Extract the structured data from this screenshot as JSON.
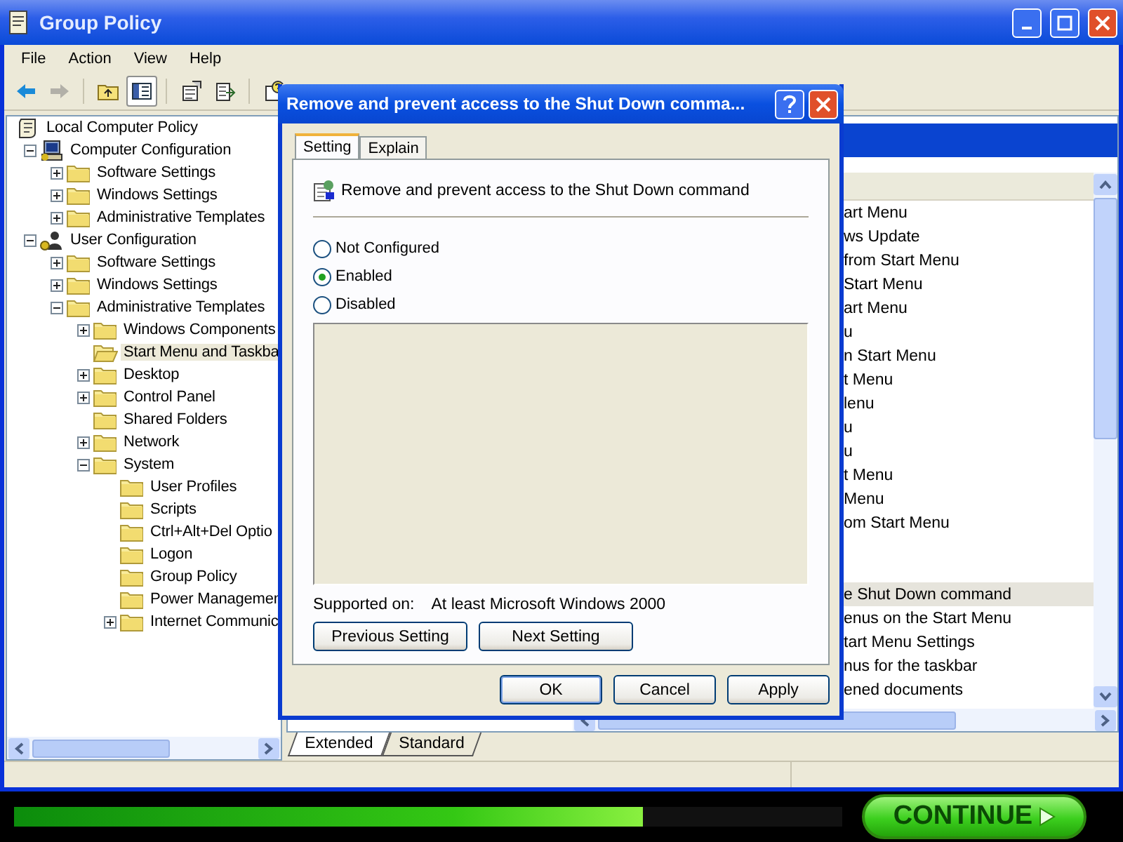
{
  "window": {
    "title": "Group Policy"
  },
  "menu": [
    "File",
    "Action",
    "View",
    "Help"
  ],
  "toolbar": [
    {
      "kind": "back",
      "disabled": false,
      "pressed": false
    },
    {
      "kind": "forward",
      "disabled": true,
      "pressed": false
    },
    {
      "kind": "up",
      "disabled": false,
      "pressed": false
    },
    {
      "kind": "tree",
      "disabled": false,
      "pressed": true
    },
    {
      "kind": "properties",
      "disabled": false,
      "pressed": false
    },
    {
      "kind": "export",
      "disabled": false,
      "pressed": false
    },
    {
      "kind": "help",
      "disabled": false,
      "pressed": false
    }
  ],
  "tree": [
    {
      "label": "Local Computer Policy",
      "kind": "policy",
      "selected": false,
      "children": [
        {
          "label": "Computer Configuration",
          "kind": "computer",
          "expanded": true,
          "selected": false,
          "children": [
            {
              "label": "Software Settings",
              "kind": "folder",
              "expanded": false,
              "selected": false
            },
            {
              "label": "Windows Settings",
              "kind": "folder",
              "expanded": false,
              "selected": false
            },
            {
              "label": "Administrative Templates",
              "kind": "folder",
              "expanded": false,
              "selected": false
            }
          ]
        },
        {
          "label": "User Configuration",
          "kind": "user",
          "expanded": true,
          "selected": false,
          "children": [
            {
              "label": "Software Settings",
              "kind": "folder",
              "expanded": false,
              "selected": false
            },
            {
              "label": "Windows Settings",
              "kind": "folder",
              "expanded": false,
              "selected": false
            },
            {
              "label": "Administrative Templates",
              "kind": "folder",
              "expanded": true,
              "selected": false,
              "children": [
                {
                  "label": "Windows Components",
                  "kind": "folder",
                  "expanded": false,
                  "selected": false
                },
                {
                  "label": "Start Menu and Taskba",
                  "kind": "folder",
                  "selected": true
                },
                {
                  "label": "Desktop",
                  "kind": "folder",
                  "expanded": false,
                  "selected": false
                },
                {
                  "label": "Control Panel",
                  "kind": "folder",
                  "expanded": false,
                  "selected": false
                },
                {
                  "label": "Shared Folders",
                  "kind": "folder",
                  "selected": false
                },
                {
                  "label": "Network",
                  "kind": "folder",
                  "expanded": false,
                  "selected": false
                },
                {
                  "label": "System",
                  "kind": "folder",
                  "expanded": true,
                  "selected": false,
                  "children": [
                    {
                      "label": "User Profiles",
                      "kind": "folder",
                      "selected": false
                    },
                    {
                      "label": "Scripts",
                      "kind": "folder",
                      "selected": false
                    },
                    {
                      "label": "Ctrl+Alt+Del Optio",
                      "kind": "folder",
                      "selected": false
                    },
                    {
                      "label": "Logon",
                      "kind": "folder",
                      "selected": false
                    },
                    {
                      "label": "Group Policy",
                      "kind": "folder",
                      "selected": false
                    },
                    {
                      "label": "Power Managemen",
                      "kind": "folder",
                      "selected": false
                    },
                    {
                      "label": "Internet Communic",
                      "kind": "folder",
                      "expanded": false,
                      "selected": false
                    }
                  ]
                }
              ]
            }
          ]
        }
      ]
    }
  ],
  "list_rows": [
    {
      "text": "art Menu",
      "selected": false
    },
    {
      "text": "ws Update",
      "selected": false
    },
    {
      "text": "from Start Menu",
      "selected": false
    },
    {
      "text": "Start Menu",
      "selected": false
    },
    {
      "text": "art Menu",
      "selected": false
    },
    {
      "text": "u",
      "selected": false
    },
    {
      "text": "n Start Menu",
      "selected": false
    },
    {
      "text": "t Menu",
      "selected": false
    },
    {
      "text": "lenu",
      "selected": false
    },
    {
      "text": "u",
      "selected": false
    },
    {
      "text": "u",
      "selected": false
    },
    {
      "text": "t Menu",
      "selected": false
    },
    {
      "text": "Menu",
      "selected": false
    },
    {
      "text": "om Start Menu",
      "selected": false
    }
  ],
  "list_rows_lower": [
    {
      "text": "e Shut Down command",
      "selected": true
    },
    {
      "text": "enus on the Start Menu",
      "selected": false
    },
    {
      "text": "tart Menu Settings",
      "selected": false
    },
    {
      "text": "nus for the taskbar",
      "selected": false
    },
    {
      "text": "ened documents",
      "selected": false
    }
  ],
  "view_tabs": [
    {
      "label": "Extended",
      "selected": true
    },
    {
      "label": "Standard",
      "selected": false
    }
  ],
  "dialog": {
    "title": "Remove and prevent access to the Shut Down comma...",
    "tabs": [
      {
        "label": "Setting",
        "selected": true
      },
      {
        "label": "Explain",
        "selected": false
      }
    ],
    "setting_name": "Remove and prevent access to the Shut Down command",
    "options": [
      {
        "label": "Not Configured",
        "selected": false
      },
      {
        "label": "Enabled",
        "selected": true
      },
      {
        "label": "Disabled",
        "selected": false
      }
    ],
    "supported_label": "Supported on:",
    "supported_value": "At least Microsoft Windows 2000",
    "nav_buttons": [
      "Previous Setting",
      "Next Setting"
    ],
    "buttons": [
      {
        "label": "OK",
        "default": true
      },
      {
        "label": "Cancel",
        "default": false
      },
      {
        "label": "Apply",
        "default": false
      }
    ]
  },
  "progress": {
    "level": 0.76
  },
  "continue_button": {
    "label": "CONTINUE"
  }
}
